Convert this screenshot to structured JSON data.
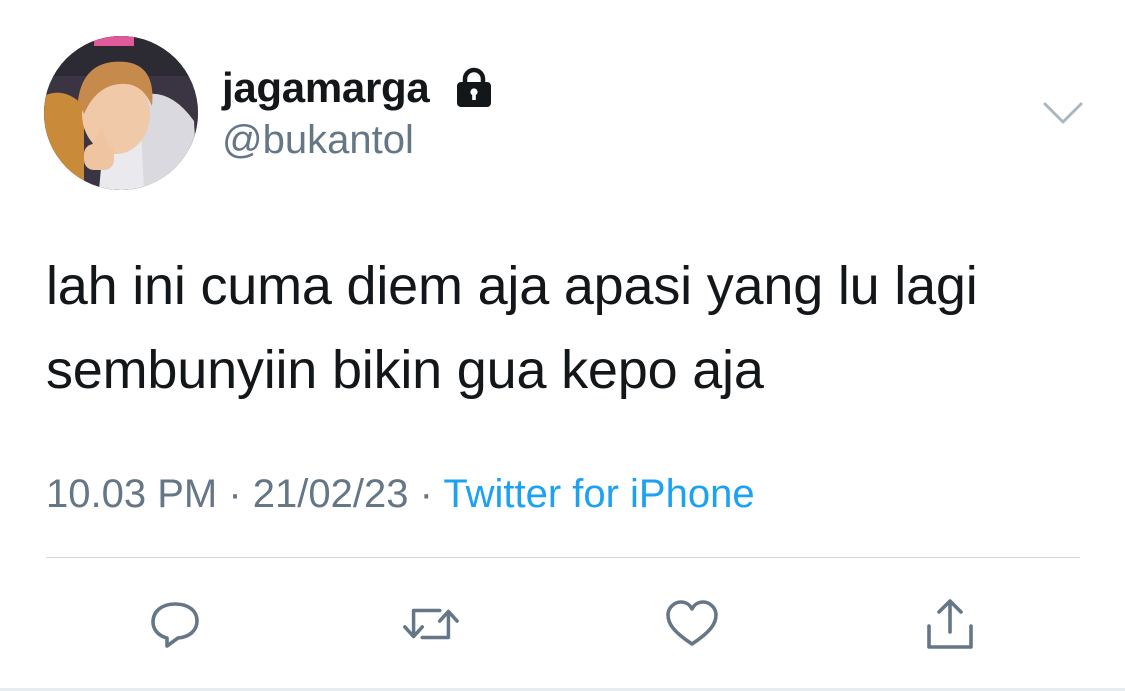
{
  "tweet": {
    "display_name": "jagamarga",
    "handle": "@bukantol",
    "protected_icon": "lock-icon",
    "text_lines": [
      "lah ini cuma diem aja apasi yang lu lagi",
      "sembunyiin bikin gua kepo aja"
    ],
    "time": "10.03 PM",
    "date": "21/02/23",
    "separator": "·",
    "source": "Twitter for iPhone"
  },
  "actions": {
    "reply_icon": "reply-icon",
    "retweet_icon": "retweet-icon",
    "like_icon": "heart-icon",
    "share_icon": "share-icon"
  },
  "colors": {
    "text": "#14171a",
    "secondary": "#657786",
    "link": "#1da1f2",
    "divider": "#ccd6dd"
  }
}
